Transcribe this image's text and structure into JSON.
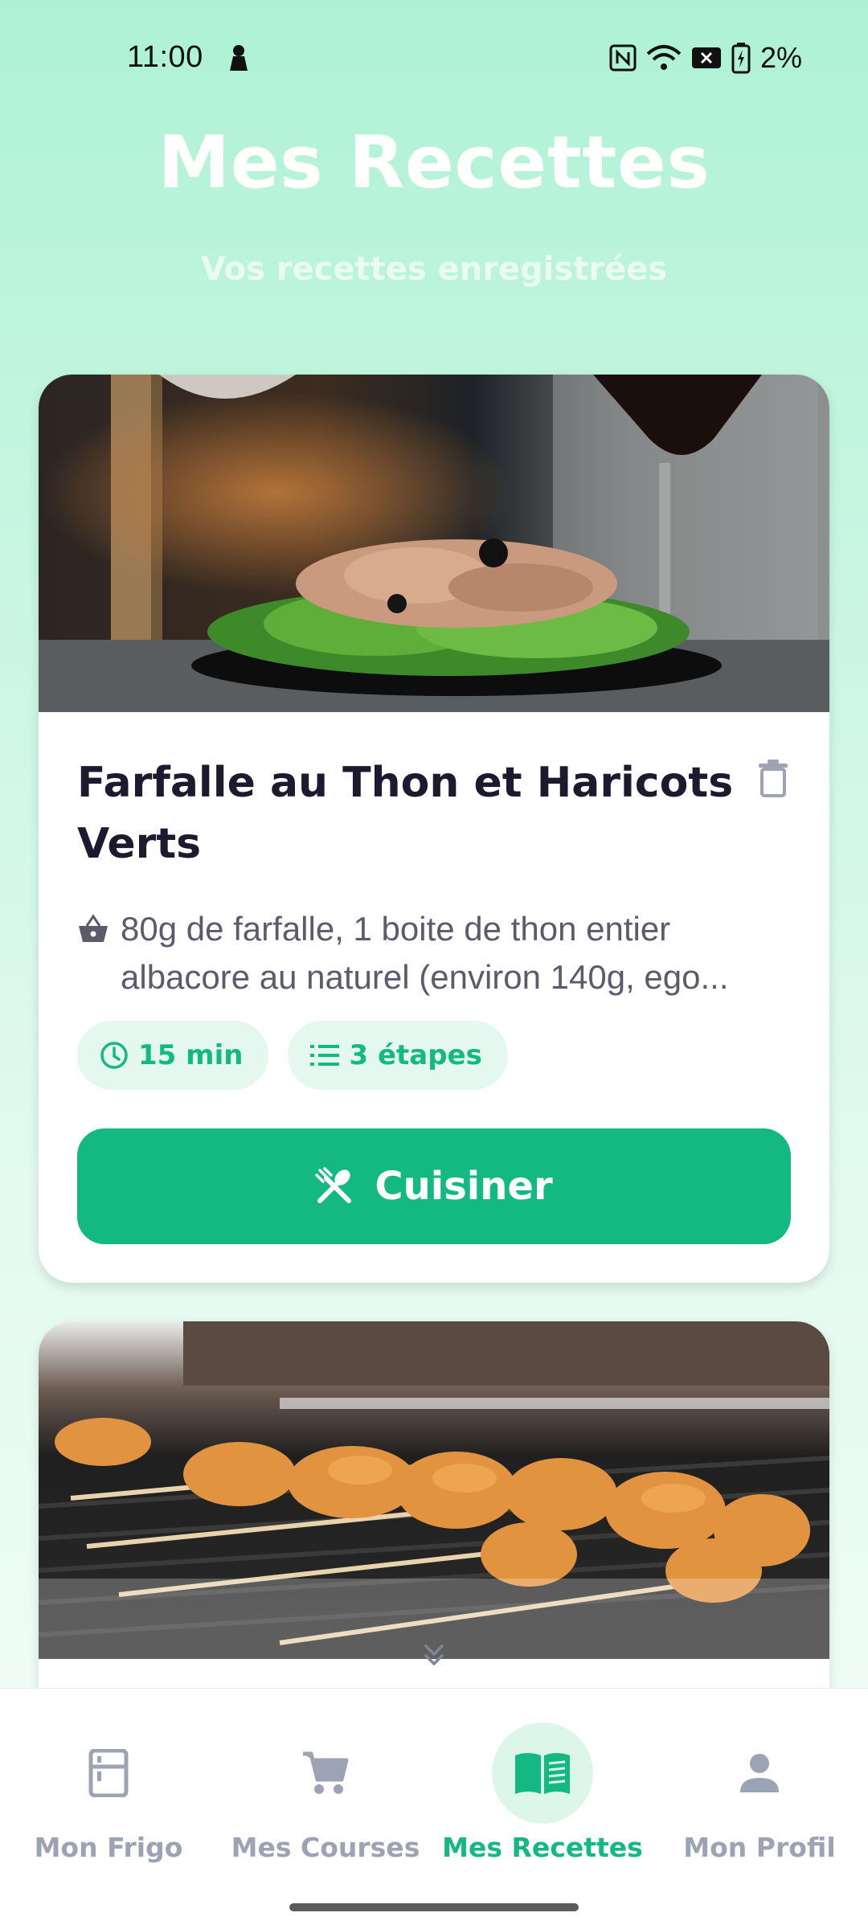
{
  "status_bar": {
    "time": "11:00",
    "battery_percent": "2%",
    "icons": [
      "notification-icon",
      "nfc-icon",
      "wifi-icon",
      "no-sim-icon",
      "battery-charging-icon"
    ]
  },
  "header": {
    "title": "Mes Recettes",
    "subtitle": "Vos recettes enregistrées"
  },
  "recipes": [
    {
      "title": "Farfalle au Thon et Haricots Verts",
      "ingredients": "80g de farfalle, 1 boite de thon entier albacore au naturel (environ 140g, ego...",
      "duration": "15 min",
      "steps": "3 étapes",
      "cook_label": "Cuisiner",
      "image": "tuna-salad-photo"
    },
    {
      "image": "chicken-skewers-photo"
    }
  ],
  "colors": {
    "accent": "#14b982",
    "chip_bg": "#e5f8ef",
    "nav_inactive": "#9ba3b4"
  },
  "bottom_nav": {
    "items": [
      {
        "label": "Mon Frigo",
        "icon": "fridge-icon",
        "active": false
      },
      {
        "label": "Mes Courses",
        "icon": "cart-icon",
        "active": false
      },
      {
        "label": "Mes Recettes",
        "icon": "book-icon",
        "active": true
      },
      {
        "label": "Mon Profil",
        "icon": "person-icon",
        "active": false
      }
    ]
  }
}
